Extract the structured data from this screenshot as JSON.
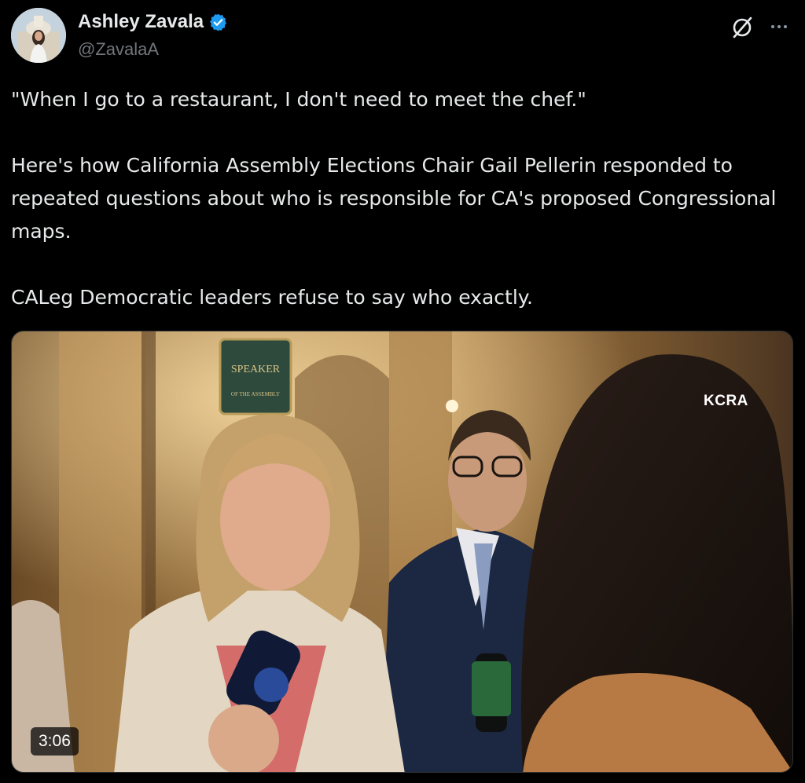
{
  "tweet": {
    "author": {
      "display_name": "Ashley Zavala",
      "handle": "@ZavalaA",
      "verified": true
    },
    "text_lines": [
      "\"When I go to a restaurant, I don't need to meet the chef.\"",
      "Here's how California Assembly Elections Chair Gail Pellerin responded to repeated questions about who is responsible for CA's proposed Congressional maps.",
      "CALeg Democratic leaders refuse to say who exactly."
    ],
    "media": {
      "type": "video",
      "duration": "3:06",
      "station_logo": "KCRA",
      "sign_text": "SPEAKER",
      "sign_subtext": "OF THE ASSEMBLY"
    }
  },
  "icons": {
    "verified": "verified-badge-icon",
    "grok": "grok-icon",
    "more": "more-options-icon"
  },
  "colors": {
    "background": "#000000",
    "text": "#e7e9ea",
    "muted": "#71767b",
    "verified": "#1d9bf0"
  }
}
